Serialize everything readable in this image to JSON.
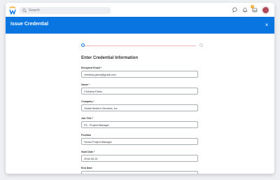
{
  "topbar": {
    "search_placeholder": "Search",
    "notification_count": "2"
  },
  "header": {
    "title": "Issue Credential",
    "close_glyph": "×",
    "background": "#0875e1"
  },
  "form": {
    "section_title": "Enter Credential Information",
    "steps": 2,
    "current_step": 1,
    "fields": [
      {
        "label": "Recipient Email *",
        "value": "christina.parks@gmail.com"
      },
      {
        "label": "Name *",
        "value": "Christina Parks"
      },
      {
        "label": "Company *",
        "value": "Global Modern Services, Inc"
      },
      {
        "label": "Job Title *",
        "value": "P3 - Project Manager"
      },
      {
        "label": "Position",
        "value": "Senior Project Manager"
      },
      {
        "label": "Start Date *",
        "value": "2018-05-15"
      },
      {
        "label": "End Date",
        "value": ""
      }
    ]
  }
}
